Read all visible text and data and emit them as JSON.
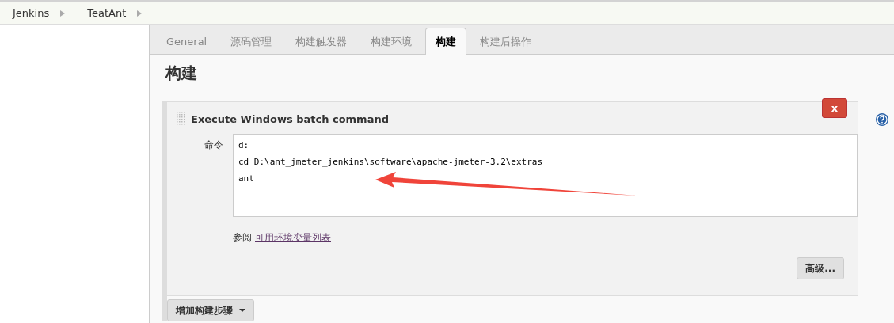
{
  "breadcrumbs": [
    "Jenkins",
    "TeatAnt"
  ],
  "tabs": [
    {
      "label": "General",
      "selected": false
    },
    {
      "label": "源码管理",
      "selected": false
    },
    {
      "label": "构建触发器",
      "selected": false
    },
    {
      "label": "构建环境",
      "selected": false
    },
    {
      "label": "构建",
      "selected": true
    },
    {
      "label": "构建后操作",
      "selected": false
    }
  ],
  "section_title": "构建",
  "build_step": {
    "title": "Execute Windows batch command",
    "delete_label": "x",
    "command_label": "命令",
    "command_value": "d:\ncd D:\\ant_jmeter_jenkins\\software\\apache-jmeter-3.2\\extras\nant",
    "see_also": "参阅",
    "env_link": "可用环境变量列表",
    "advanced_button": "高级..."
  },
  "add_step_button": "增加构建步骤"
}
